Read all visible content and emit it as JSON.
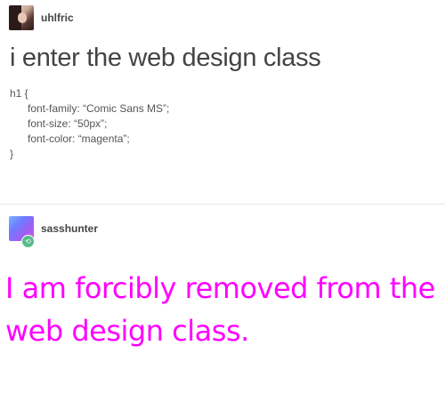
{
  "post1": {
    "username": "uhlfric",
    "avatar_icon": "user-avatar-photo",
    "title": "i enter the web design class",
    "code_lines": [
      "h1 {",
      "font-family: “Comic Sans MS”;",
      "font-size: “50px”;",
      "font-color: “magenta”;",
      "}"
    ]
  },
  "post2": {
    "username": "sasshunter",
    "avatar_icon": "gradient-avatar",
    "reblog_icon": "reblog-icon",
    "reply_text": "I am forcibly removed from the web design class.",
    "reply_color": "#ff00ff"
  }
}
